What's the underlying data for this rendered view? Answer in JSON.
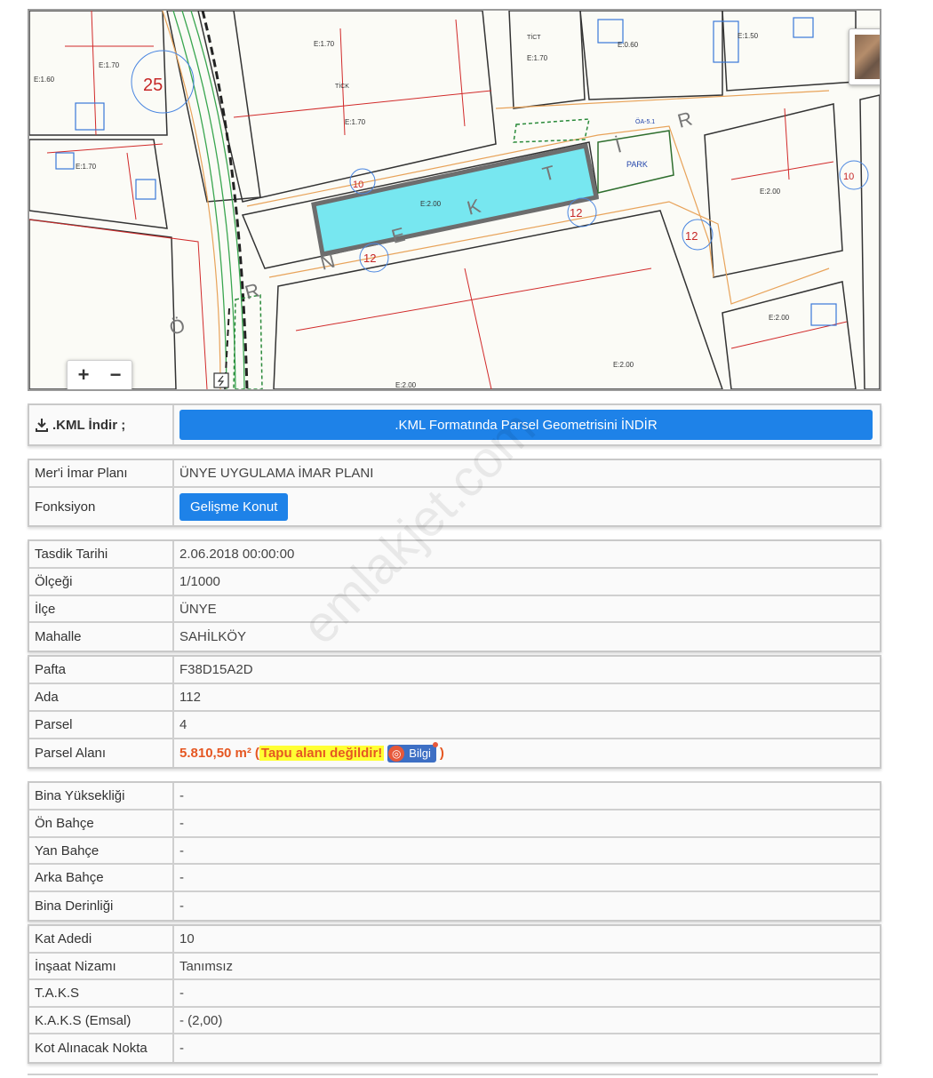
{
  "map": {
    "zoom_in": "+",
    "zoom_out": "−",
    "street_letters_top": [
      "N",
      "E",
      "K",
      "T",
      "İ",
      "R"
    ],
    "street_letters_left": [
      "Ö",
      "R"
    ],
    "labels": {
      "road_25": "25",
      "road_10": "10",
      "road_12a": "12",
      "road_12b": "12",
      "road_12c": "12",
      "road_10b": "10",
      "park": "PARK",
      "oa": "ÖA-5.1",
      "e_parcel": "E:2.00",
      "e1": "E:1.70",
      "e2": "E:1.70",
      "e3": "E:1.70",
      "e4": "E:0.60",
      "e5": "E:1.50",
      "e6": "E:1.60",
      "e7": "E:1.70",
      "e8": "E:1.70",
      "e9": "E:2.00",
      "e10": "E:2.00",
      "e11": "E:2.00",
      "e12": "E:2.00",
      "tick": "TİCK",
      "tict": "TİCT"
    }
  },
  "kml": {
    "label": ".KML İndir ;",
    "button": ".KML Formatında Parsel Geometrisini İNDİR"
  },
  "plan": {
    "rows": [
      {
        "label": "Mer'i İmar Planı",
        "value": "ÜNYE UYGULAMA İMAR PLANI"
      },
      {
        "label": "Fonksiyon",
        "value": "Gelişme Konut"
      }
    ]
  },
  "location": {
    "rows": [
      {
        "label": "Tasdik Tarihi",
        "value": "2.06.2018 00:00:00"
      },
      {
        "label": "Ölçeği",
        "value": "1/1000"
      },
      {
        "label": "İlçe",
        "value": "ÜNYE"
      },
      {
        "label": "Mahalle",
        "value": "SAHİLKÖY"
      }
    ]
  },
  "parcel": {
    "rows": [
      {
        "label": "Pafta",
        "value": "F38D15A2D"
      },
      {
        "label": "Ada",
        "value": "112"
      },
      {
        "label": "Parsel",
        "value": "4"
      },
      {
        "label": "Parsel Alanı",
        "value": "5.810,50 m²"
      }
    ],
    "area_open": "(",
    "warning": "Tapu alanı değildir!",
    "info_button": "Bilgi",
    "area_close": ")"
  },
  "garden": {
    "rows": [
      {
        "label": "Bina Yüksekliği",
        "value": "-"
      },
      {
        "label": "Ön Bahçe",
        "value": "-"
      },
      {
        "label": "Yan Bahçe",
        "value": "-"
      },
      {
        "label": "Arka Bahçe",
        "value": "-"
      },
      {
        "label": "Bina Derinliği",
        "value": "-"
      }
    ]
  },
  "build": {
    "rows": [
      {
        "label": "Kat Adedi",
        "value": "10"
      },
      {
        "label": "İnşaat Nizamı",
        "value": "Tanımsız"
      },
      {
        "label": "T.A.K.S",
        "value": "-"
      },
      {
        "label": "K.A.K.S (Emsal)",
        "value": "- (2,00)"
      },
      {
        "label": "Kot Alınacak Nokta",
        "value": "-"
      }
    ]
  },
  "watermark": "emlakjet.com"
}
